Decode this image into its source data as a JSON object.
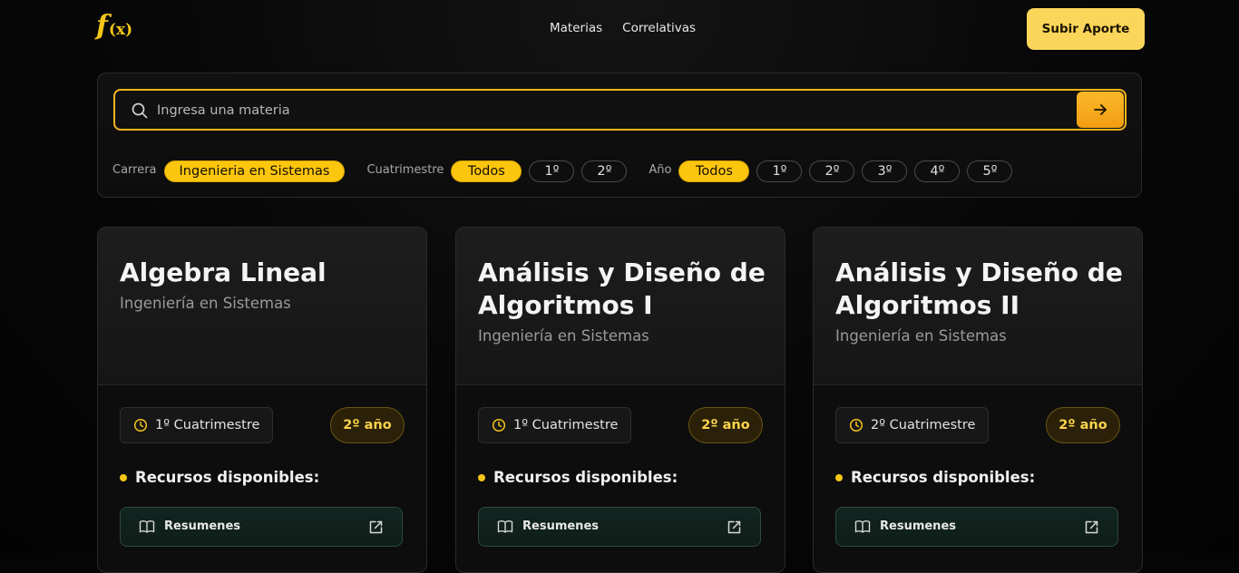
{
  "header": {
    "logo_f": "f",
    "logo_x": "(x)",
    "nav": [
      "Materias",
      "Correlativas"
    ],
    "upload_label": "Subir Aporte"
  },
  "search": {
    "placeholder": "Ingresa una materia",
    "value": ""
  },
  "filters": {
    "carrera": {
      "label": "Carrera",
      "options": [
        "Ingenieria en Sistemas"
      ],
      "selected": "Ingenieria en Sistemas"
    },
    "cuatrimestre": {
      "label": "Cuatrimestre",
      "options": [
        "Todos",
        "1º",
        "2º"
      ],
      "selected": "Todos"
    },
    "anio": {
      "label": "Año",
      "options": [
        "Todos",
        "1º",
        "2º",
        "3º",
        "4º",
        "5º"
      ],
      "selected": "Todos"
    }
  },
  "cards": [
    {
      "title": "Algebra Lineal",
      "career": "Ingeniería en Sistemas",
      "cuatrimestre": "1º Cuatrimestre",
      "year": "2º año",
      "resources_title": "Recursos disponibles:",
      "resource": "Resumenes"
    },
    {
      "title": "Análisis y Diseño de Algoritmos I",
      "career": "Ingeniería en Sistemas",
      "cuatrimestre": "1º Cuatrimestre",
      "year": "2º año",
      "resources_title": "Recursos disponibles:",
      "resource": "Resumenes"
    },
    {
      "title": "Análisis y Diseño de Algoritmos II",
      "career": "Ingeniería en Sistemas",
      "cuatrimestre": "2º Cuatrimestre",
      "year": "2º año",
      "resources_title": "Recursos disponibles:",
      "resource": "Resumenes"
    }
  ],
  "colors": {
    "accent": "#f5c518",
    "search_border": "#f5b51b",
    "upload_bg": "#fcd65a",
    "resource_bg": "#122520"
  }
}
